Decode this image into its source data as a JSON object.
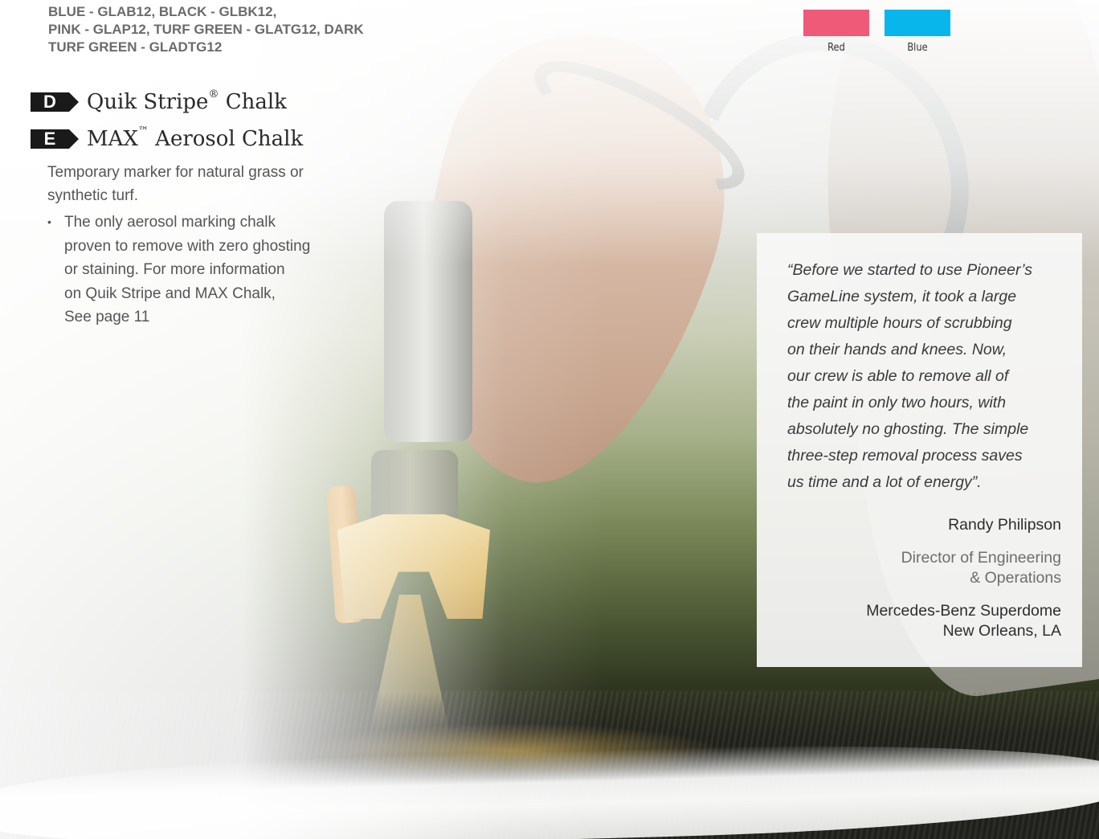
{
  "product_codes": {
    "lines": [
      "BLUE - GLAB12, BLACK - GLBK12,",
      "PINK - GLAP12, TURF GREEN - GLATG12, DARK",
      "TURF GREEN - GLADTG12"
    ]
  },
  "sections": [
    {
      "letter": "D",
      "title": "Quik Stripe",
      "mark": "®",
      "suffix": " Chalk"
    },
    {
      "letter": "E",
      "title": "MAX",
      "mark": "™",
      "suffix": " Aerosol Chalk"
    }
  ],
  "description": {
    "intro": "Temporary marker for natural grass or synthetic turf.",
    "bullets": [
      {
        "marker": "•",
        "lines": [
          "The only aerosol marking chalk",
          "proven to remove with zero ghosting",
          "or staining. For more information",
          "on Quik Stripe and MAX Chalk,",
          "See page 11"
        ]
      }
    ]
  },
  "swatches": [
    {
      "label": "Red",
      "color": "#ef5a78"
    },
    {
      "label": "Blue",
      "color": "#08b6ec"
    }
  ],
  "testimonial": {
    "quote_lines": [
      "“Before we started to use Pioneer’s",
      "GameLine system, it took a large",
      "crew multiple hours of scrubbing",
      "on their hands and knees. Now,",
      "our crew is able to remove all of",
      "the paint in only two hours, with",
      "absolutely no ghosting. The simple",
      "three-step removal process saves",
      "us time and a lot of energy”."
    ],
    "name": "Randy Philipson",
    "title_lines": [
      "Director of Engineering",
      "& Operations"
    ],
    "org_lines": [
      "Mercedes-Benz Superdome",
      "New Orleans, LA"
    ]
  },
  "colors": {
    "badge": "#1a1a1a",
    "body_text": "#555555",
    "testimonial_bg": "#f8f8f7"
  }
}
